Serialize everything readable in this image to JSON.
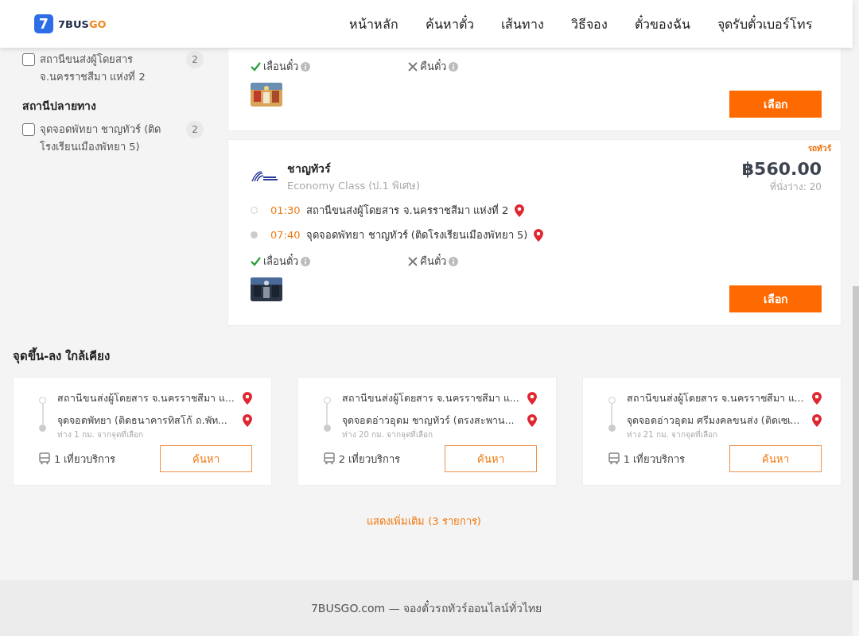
{
  "header": {
    "logo": {
      "mark": "7",
      "primary": "7BUS",
      "accent": "GO"
    },
    "nav": [
      {
        "label": "หน้าหลัก"
      },
      {
        "label": "ค้นหาตั๋ว"
      },
      {
        "label": "เส้นทาง"
      },
      {
        "label": "วิธีจอง"
      },
      {
        "label": "ตั๋วของฉัน"
      },
      {
        "label": "จุดรับตั๋วเบอร์โทร"
      }
    ]
  },
  "sidebar": {
    "groups": [
      {
        "items": [
          {
            "label": "สถานีขนส่งผู้โดยสาร จ.นครราชสีมา แห่งที่ 2",
            "count": "2",
            "checked": false
          }
        ]
      },
      {
        "title": "สถานีปลายทาง",
        "items": [
          {
            "label": "จุดจอดพัทยา ชาญทัวร์ (ติดโรงเรียนเมืองพัทยา 5)",
            "count": "2",
            "checked": false
          }
        ]
      }
    ]
  },
  "trips": [
    {
      "features": [
        {
          "label": "เลื่อนตั๋ว",
          "available": true
        },
        {
          "label": "คืนตั๋ว",
          "available": false
        }
      ],
      "photo": {
        "kind": "picture"
      },
      "button": "เลือก"
    },
    {
      "tag": "รถทัวร์",
      "operator": "ชาญทัวร์",
      "class": "Economy Class (ป.1 พิเศษ)",
      "price": "฿560.00",
      "seats": "ที่นั่งว่าง: 20",
      "stops": [
        {
          "time": "01:30",
          "name": "สถานีขนส่งผู้โดยสาร จ.นครราชสีมา แห่งที่ 2",
          "kind": "origin"
        },
        {
          "time": "07:40",
          "name": "จุดจอดพัทยา ชาญทัวร์ (ติดโรงเรียนเมืองพัทยา 5)",
          "kind": "destination"
        }
      ],
      "features": [
        {
          "label": "เลื่อนตั๋ว",
          "available": true
        },
        {
          "label": "คืนตั๋ว",
          "available": false
        }
      ],
      "photo": {
        "kind": "picture"
      },
      "button": "เลือก"
    }
  ],
  "nearby": {
    "title": "จุดขึ้น-ลง ใกล้เคียง",
    "cards": [
      {
        "from": "สถานีขนส่งผู้โดยสาร จ.นครราชสีมา แ...",
        "to": "จุดจอดพัทยา (ติดธนาคารทิสโก้ ถ.พัท...",
        "distance": "ห่าง 1 กม. จากจุดที่เลือก",
        "trips": "1 เที่ยวบริการ",
        "button": "ค้นหา"
      },
      {
        "from": "สถานีขนส่งผู้โดยสาร จ.นครราชสีมา แ...",
        "to": "จุดจอดอ่าวอุดม ชาญทัวร์ (ตรงสะพาน...",
        "distance": "ห่าง 20 กม. จากจุดที่เลือก",
        "trips": "2 เที่ยวบริการ",
        "button": "ค้นหา"
      },
      {
        "from": "สถานีขนส่งผู้โดยสาร จ.นครราชสีมา แ...",
        "to": "จุดจอดอ่าวอุดม ศรีมงคลขนส่ง (ติดเซเ...",
        "distance": "ห่าง 21 กม. จากจุดที่เลือก",
        "trips": "1 เที่ยวบริการ",
        "button": "ค้นหา"
      }
    ],
    "more": "แสดงเพิ่มเติม (3 รายการ)"
  },
  "footer": {
    "text": "7BUSGO.com — จองตั๋วรถทัวร์ออนไลน์ทั่วไทย"
  }
}
